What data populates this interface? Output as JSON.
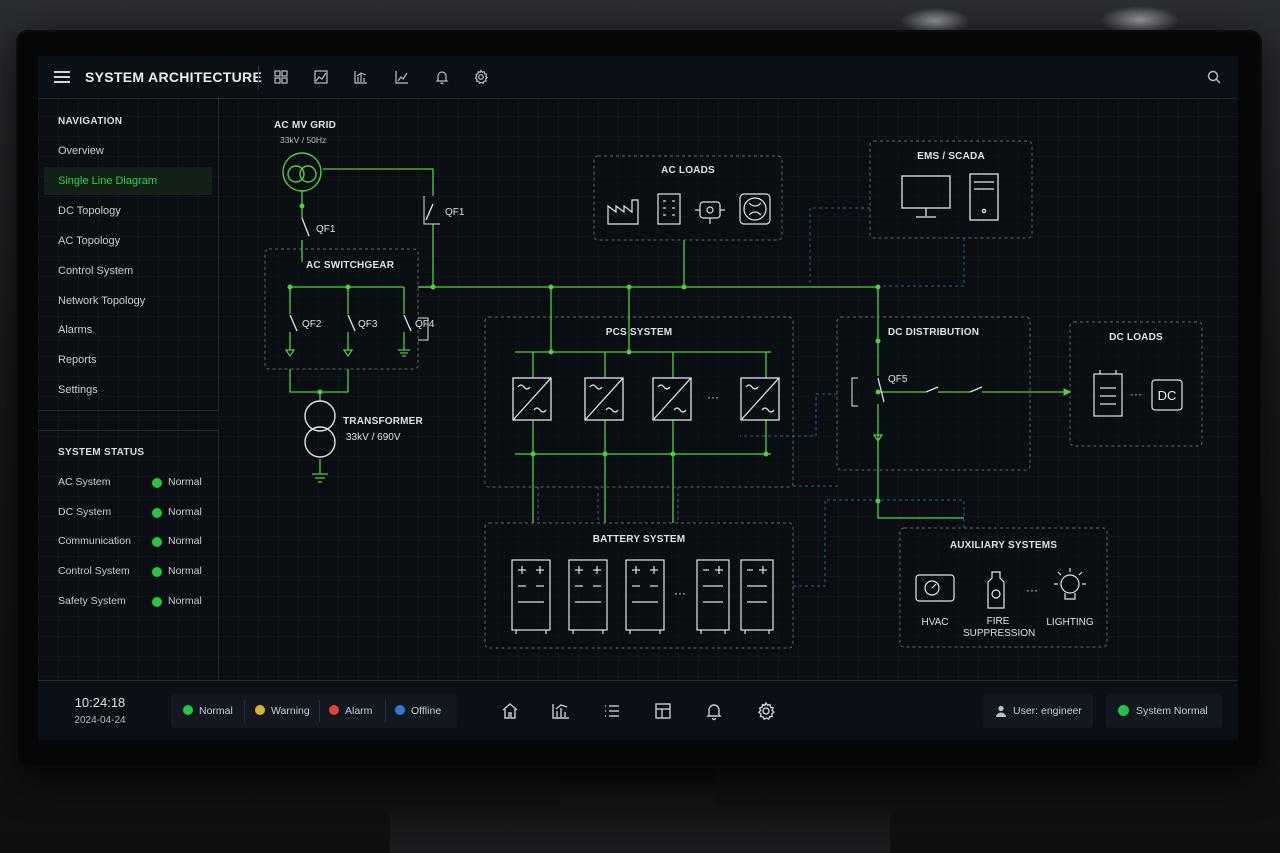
{
  "header": {
    "title": "SYSTEM ARCHITECTURE"
  },
  "sidebar": {
    "nav_title": "NAVIGATION",
    "items": [
      {
        "label": "Overview"
      },
      {
        "label": "Single Line Diagram"
      },
      {
        "label": "DC Topology"
      },
      {
        "label": "AC Topology"
      },
      {
        "label": "Control System"
      },
      {
        "label": "Network Topology"
      },
      {
        "label": "Alarms"
      },
      {
        "label": "Reports"
      },
      {
        "label": "Settings"
      }
    ],
    "active_index": 1,
    "status_title": "SYSTEM STATUS",
    "status": [
      {
        "label": "AC System",
        "value": "Normal"
      },
      {
        "label": "DC System",
        "value": "Normal"
      },
      {
        "label": "Communication",
        "value": "Normal"
      },
      {
        "label": "Control System",
        "value": "Normal"
      },
      {
        "label": "Safety System",
        "value": "Normal"
      }
    ]
  },
  "diagram": {
    "grid": {
      "title": "AC MV GRID",
      "rating": "33kV / 50Hz"
    },
    "qf1_left": "QF1",
    "qf1_right": "QF1",
    "switchgear": {
      "title": "AC SWITCHGEAR",
      "qf2": "QF2",
      "qf3": "QF3",
      "qf4": "QF4"
    },
    "transformer": {
      "title": "TRANSFORMER",
      "rating": "33kV / 690V"
    },
    "ac_loads": {
      "title": "AC LOADS"
    },
    "ems": {
      "title": "EMS / SCADA"
    },
    "pcs": {
      "title": "PCS SYSTEM",
      "ellipsis": "···"
    },
    "dc_distribution": {
      "title": "DC DISTRIBUTION",
      "qf5": "QF5"
    },
    "dc_loads": {
      "title": "DC LOADS",
      "ellipsis": "···",
      "dc_label": "DC"
    },
    "battery": {
      "title": "BATTERY SYSTEM",
      "ellipsis": "···"
    },
    "auxiliary": {
      "title": "AUXILIARY SYSTEMS",
      "ellipsis": "···",
      "hvac": "HVAC",
      "fire_line1": "FIRE",
      "fire_line2": "SUPPRESSION",
      "lighting": "LIGHTING"
    }
  },
  "footer": {
    "time": "10:24:18",
    "date": "2024-04-24",
    "legend": [
      {
        "label": "Normal",
        "color": "#27c53f"
      },
      {
        "label": "Warning",
        "color": "#d9b43a"
      },
      {
        "label": "Alarm",
        "color": "#e0403a"
      },
      {
        "label": "Offline",
        "color": "#2f78d8"
      }
    ],
    "user": "User: engineer",
    "system_status": "System Normal"
  },
  "colors": {
    "accent": "#34d24b",
    "line": "#4fd13f",
    "control_line": "#2f5f8f"
  }
}
